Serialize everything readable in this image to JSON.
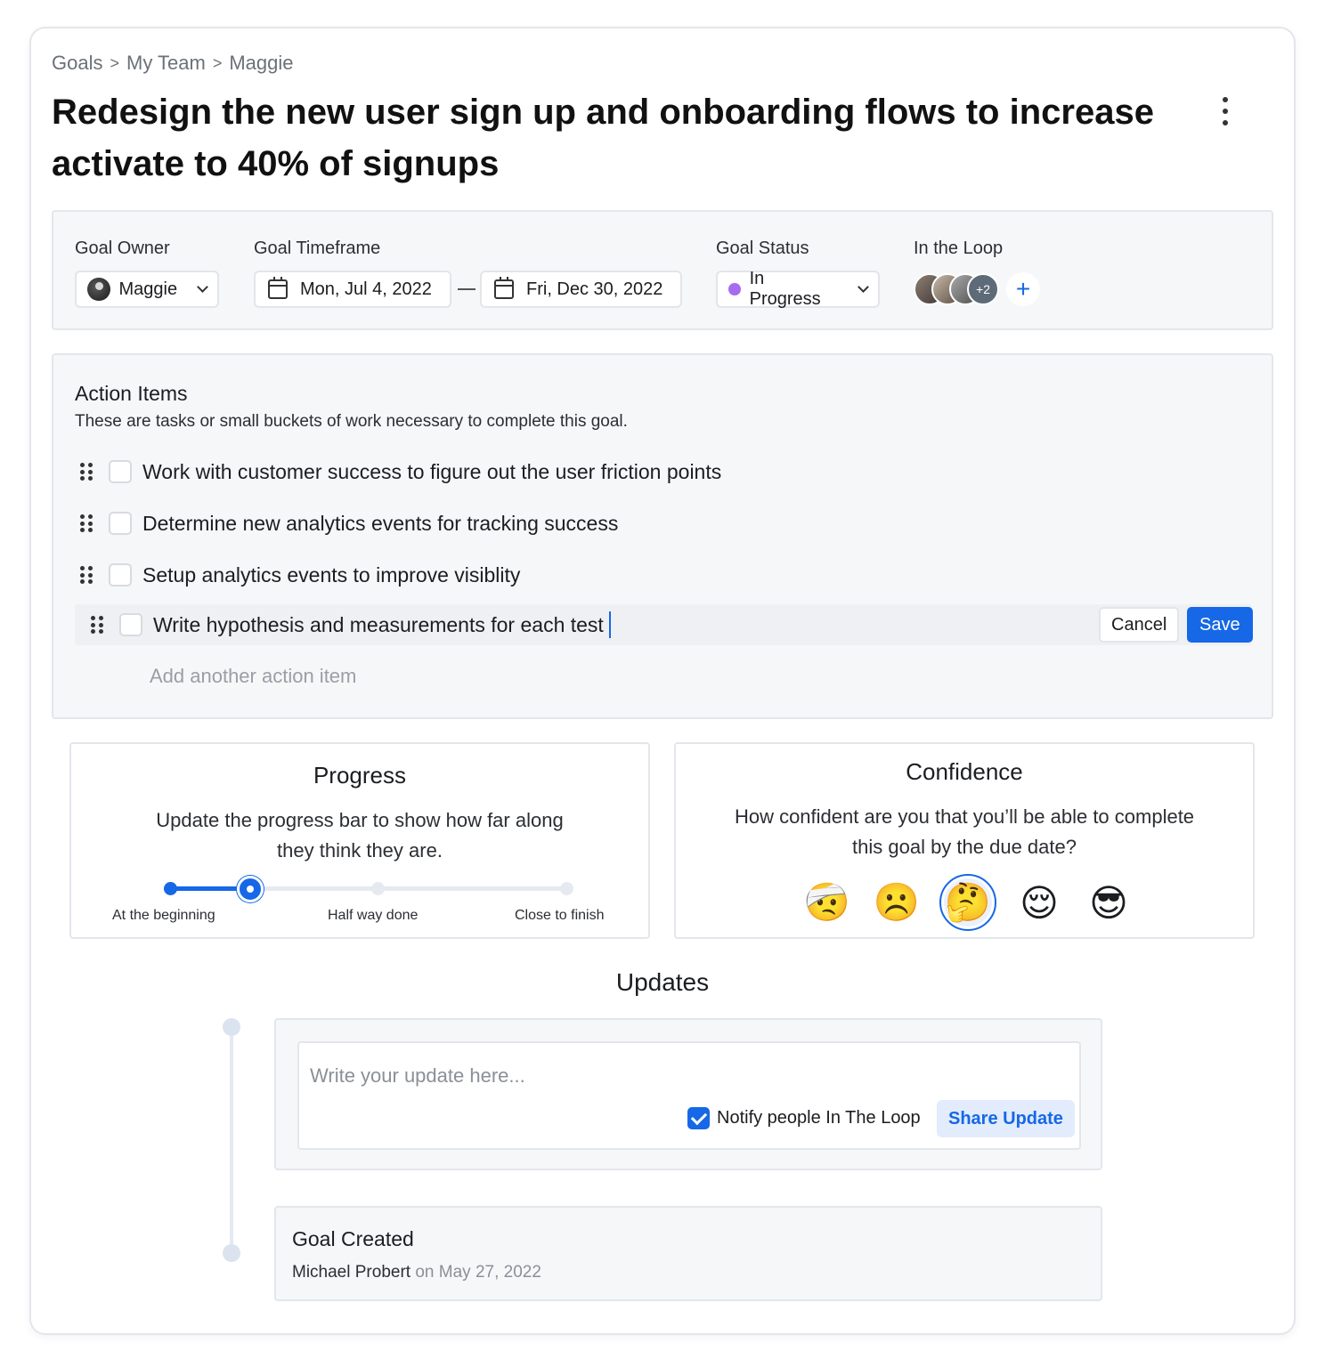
{
  "breadcrumb": [
    "Goals",
    "My Team",
    "Maggie"
  ],
  "breadcrumb_sep": ">",
  "title": "Redesign the new user sign up and onboarding flows to increase activate to 40% of signups",
  "meta": {
    "owner_label": "Goal Owner",
    "owner_value": "Maggie",
    "timeframe_label": "Goal Timeframe",
    "start_date": "Mon, Jul 4, 2022",
    "end_date": "Fri, Dec 30, 2022",
    "status_label": "Goal Status",
    "status_value": "In Progress",
    "status_color": "#a66cf0",
    "loop_label": "In the Loop",
    "loop_more": "+2",
    "loop_add": "+"
  },
  "action_items": {
    "title": "Action Items",
    "subtitle": "These are tasks or small buckets of work necessary to complete this goal.",
    "items": [
      {
        "text": "Work with customer success to figure out the user friction points",
        "checked": false
      },
      {
        "text": "Determine new analytics events for tracking success",
        "checked": false
      },
      {
        "text": "Setup analytics events to improve visiblity",
        "checked": false
      }
    ],
    "editing_text": "Write hypothesis and measurements for each test",
    "cancel_label": "Cancel",
    "save_label": "Save",
    "add_placeholder": "Add another action item"
  },
  "progress": {
    "title": "Progress",
    "description": "Update the progress bar to show how far along they think they are.",
    "labels": [
      "At the beginning",
      "Half way done",
      "Close to finish"
    ],
    "value_fraction": 0.216
  },
  "confidence": {
    "title": "Confidence",
    "description": "How confident are you that you’ll be able to complete this goal by the due date?",
    "emojis": [
      "🤕",
      "☹️",
      "🤔",
      "😌",
      "😎"
    ],
    "selected_index": 2
  },
  "updates": {
    "title": "Updates",
    "input_placeholder": "Write your update here...",
    "notify_label": "Notify people In The Loop",
    "notify_checked": true,
    "share_label": "Share Update",
    "created_title": "Goal Created",
    "created_by": "Michael Probert",
    "created_on_word": "on",
    "created_date": "May 27, 2022"
  },
  "colors": {
    "accent": "#1668e6",
    "panel_bg": "#f6f7f9",
    "border": "#e3e6eb"
  },
  "icons": [
    "kebab-menu-icon",
    "chevron-down-icon",
    "calendar-icon",
    "drag-handle-icon",
    "plus-icon",
    "checkbox-checked-icon"
  ]
}
